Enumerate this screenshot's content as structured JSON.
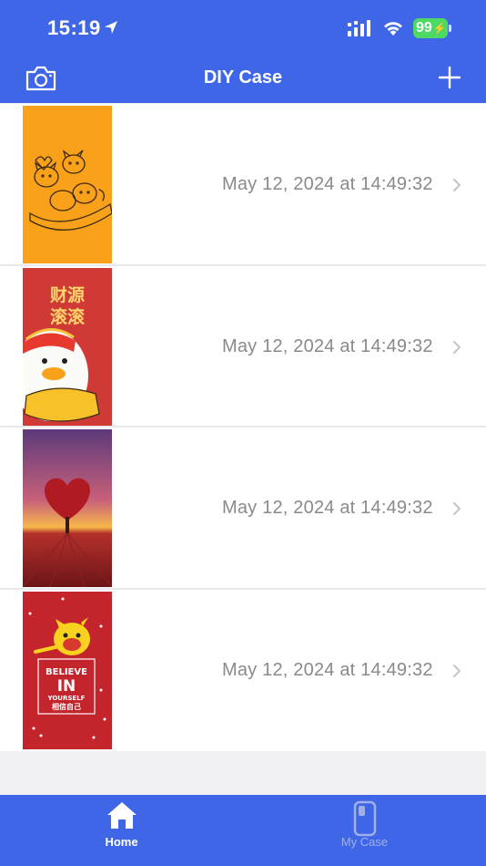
{
  "status": {
    "time": "15:19",
    "battery": "99"
  },
  "nav": {
    "title": "DIY Case"
  },
  "list": {
    "items": [
      {
        "date": "May 12, 2024 at 14:49:32",
        "art": "orange-cartoon-dogs"
      },
      {
        "date": "May 12, 2024 at 14:49:32",
        "art": "red-duck-caiyuan-gungun"
      },
      {
        "date": "May 12, 2024 at 14:49:32",
        "art": "heart-tree-sunset"
      },
      {
        "date": "May 12, 2024 at 14:49:32",
        "art": "believe-in-yourself"
      }
    ],
    "art_text": {
      "caiyuan": "财源",
      "gungun": "滚滚",
      "believe": "BELIEVE",
      "in": "IN",
      "yourself": "YOURSELF",
      "xiangxin": "相信自己"
    }
  },
  "tabs": [
    {
      "label": "Home",
      "icon": "home-icon",
      "active": true
    },
    {
      "label": "My Case",
      "icon": "phone-case-icon",
      "active": false
    }
  ],
  "colors": {
    "brand": "#3f66e6",
    "battery": "#4cd964",
    "date_text": "#8a8a8e"
  }
}
